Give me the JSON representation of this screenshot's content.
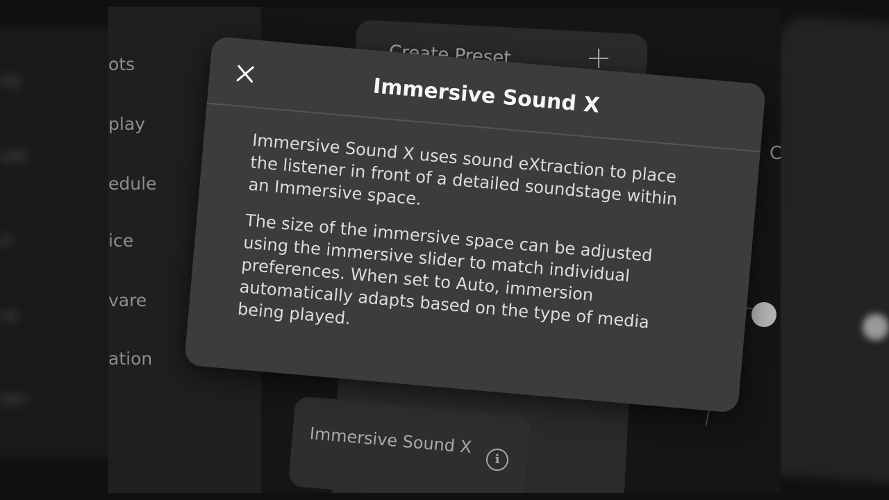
{
  "background_left": {
    "ghost_items": [
      "ay",
      "ule",
      "e",
      "re",
      "ion"
    ]
  },
  "settings_list": {
    "items": [
      "ots",
      "play",
      "edule",
      "ice",
      "vare",
      "ation"
    ]
  },
  "preset_panel": {
    "create_label": "Create Preset"
  },
  "bottom_card": {
    "label": "Immersive Sound X"
  },
  "right_panel": {
    "partial_label": "C"
  },
  "modal": {
    "title": "Immersive Sound X",
    "paragraphs": [
      "Immersive Sound X uses sound eXtraction to place the listener in front of a detailed soundstage within an Immersive space.",
      "The size of the immersive space can be adjusted using the immersive slider to match individual preferences. When set to Auto, immersion automatically adapts based on the type of media being played."
    ]
  },
  "colors": {
    "modal_bg": "#3c3c3c",
    "text": "#dcdcdc",
    "title": "#f5f5f5"
  }
}
